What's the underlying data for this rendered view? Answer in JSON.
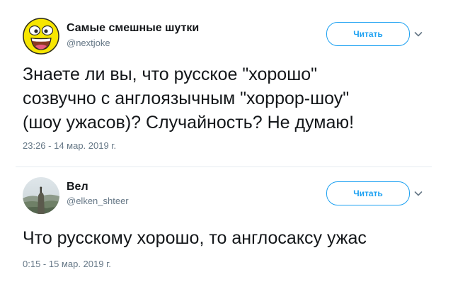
{
  "tweets": [
    {
      "author_name": "Самые смешные шутки",
      "author_handle": "@nextjoke",
      "avatar_icon": "smiley-face-icon",
      "follow_label": "Читать",
      "text": "Знаете ли вы, что русское \"хорошо\"\nсозвучно с англоязычным \"хоррор-шоу\"\n(шоу ужасов)? Случайность? Не думаю!",
      "timestamp": "23:26 - 14 мар. 2019 г."
    },
    {
      "author_name": "Вел",
      "author_handle": "@elken_shteer",
      "avatar_icon": "landscape-photo-avatar",
      "follow_label": "Читать",
      "text": "Что русскому хорошо, то англосаксу ужас",
      "timestamp": "0:15 - 15 мар. 2019 г."
    }
  ],
  "colors": {
    "accent": "#1da1f2",
    "text": "#14171a",
    "secondary": "#657786",
    "divider": "#e6ecf0"
  },
  "icons": {
    "menu": "chevron-down-icon"
  }
}
